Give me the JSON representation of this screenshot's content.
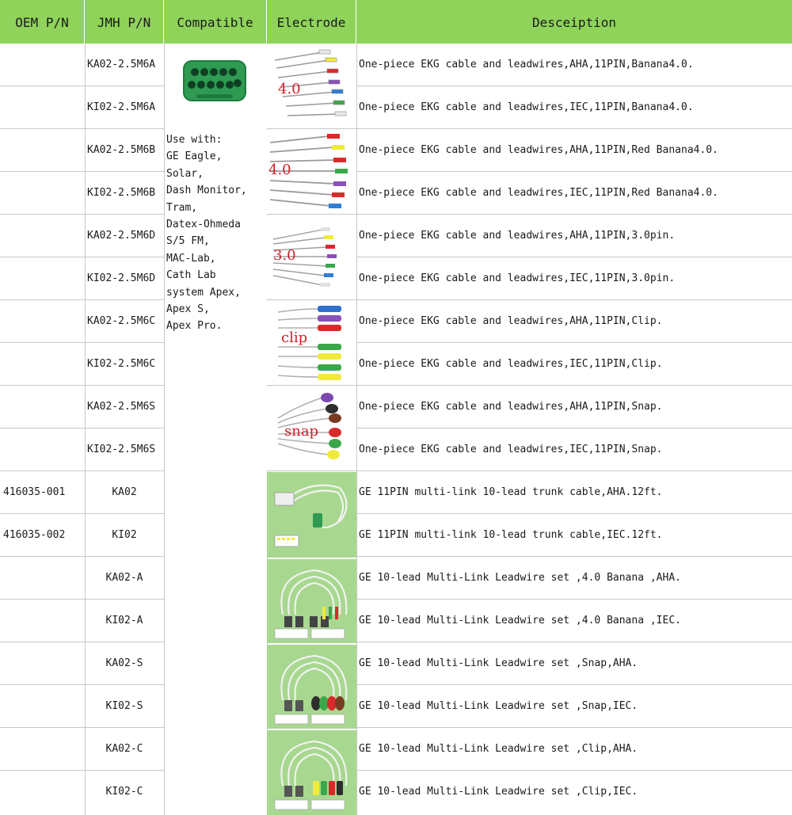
{
  "header": {
    "oem": "OEM P/N",
    "jmh": "JMH P/N",
    "compatible": "Compatible",
    "electrode": "Electrode",
    "description": "Desceiption"
  },
  "compatible_text": [
    "Use with:",
    "GE Eagle,",
    "Solar,",
    "Dash Monitor,",
    "Tram,",
    "Datex-Ohmeda",
    "S/5 FM,",
    "MAC-Lab,",
    "Cath Lab",
    "system Apex,",
    "Apex S,",
    "Apex Pro."
  ],
  "electrode_labels": {
    "banana": "4.0",
    "red_banana": "4.0",
    "pin": "3.0",
    "clip": "clip",
    "snap": "snap"
  },
  "rows": [
    {
      "oem": "",
      "jmh": "KA02-2.5M6A",
      "desc": "One-piece EKG cable and leadwires,AHA,11PIN,Banana4.0."
    },
    {
      "oem": "",
      "jmh": "KI02-2.5M6A",
      "desc": "One-piece EKG cable and leadwires,IEC,11PIN,Banana4.0."
    },
    {
      "oem": "",
      "jmh": "KA02-2.5M6B",
      "desc": "One-piece EKG cable and leadwires,AHA,11PIN,Red Banana4.0."
    },
    {
      "oem": "",
      "jmh": "KI02-2.5M6B",
      "desc": "One-piece EKG cable and leadwires,IEC,11PIN,Red Banana4.0."
    },
    {
      "oem": "",
      "jmh": "KA02-2.5M6D",
      "desc": "One-piece EKG cable and leadwires,AHA,11PIN,3.0pin."
    },
    {
      "oem": "",
      "jmh": "KI02-2.5M6D",
      "desc": "One-piece EKG cable and leadwires,IEC,11PIN,3.0pin."
    },
    {
      "oem": "",
      "jmh": "KA02-2.5M6C",
      "desc": "One-piece EKG cable and leadwires,AHA,11PIN,Clip."
    },
    {
      "oem": "",
      "jmh": "KI02-2.5M6C",
      "desc": "One-piece EKG cable and leadwires,IEC,11PIN,Clip."
    },
    {
      "oem": "",
      "jmh": "KA02-2.5M6S",
      "desc": "One-piece EKG cable and leadwires,AHA,11PIN,Snap."
    },
    {
      "oem": "",
      "jmh": "KI02-2.5M6S",
      "desc": "One-piece EKG cable and leadwires,IEC,11PIN,Snap."
    },
    {
      "oem": "416035-001",
      "jmh": "KA02",
      "desc": "GE 11PIN multi-link 10-lead trunk cable,AHA.12ft."
    },
    {
      "oem": "416035-002",
      "jmh": "KI02",
      "desc": "GE 11PIN multi-link 10-lead trunk cable,IEC.12ft."
    },
    {
      "oem": "",
      "jmh": "KA02-A",
      "desc": "GE 10-lead Multi-Link Leadwire set ,4.0 Banana ,AHA."
    },
    {
      "oem": "",
      "jmh": "KI02-A",
      "desc": "GE 10-lead Multi-Link Leadwire set ,4.0 Banana ,IEC."
    },
    {
      "oem": "",
      "jmh": "KA02-S",
      "desc": "GE 10-lead Multi-Link Leadwire set ,Snap,AHA."
    },
    {
      "oem": "",
      "jmh": "KI02-S",
      "desc": "GE 10-lead Multi-Link Leadwire set ,Snap,IEC."
    },
    {
      "oem": "",
      "jmh": "KA02-C",
      "desc": "GE 10-lead Multi-Link Leadwire set ,Clip,AHA."
    },
    {
      "oem": "",
      "jmh": "KI02-C",
      "desc": "GE 10-lead Multi-Link Leadwire set ,Clip,IEC."
    }
  ],
  "colors": {
    "header_bg": "#8fd35a",
    "connector_green": "#2e9a52",
    "photo_green": "#a8d890",
    "grid": "#c8c8c8",
    "label_red": "#d0202a"
  }
}
